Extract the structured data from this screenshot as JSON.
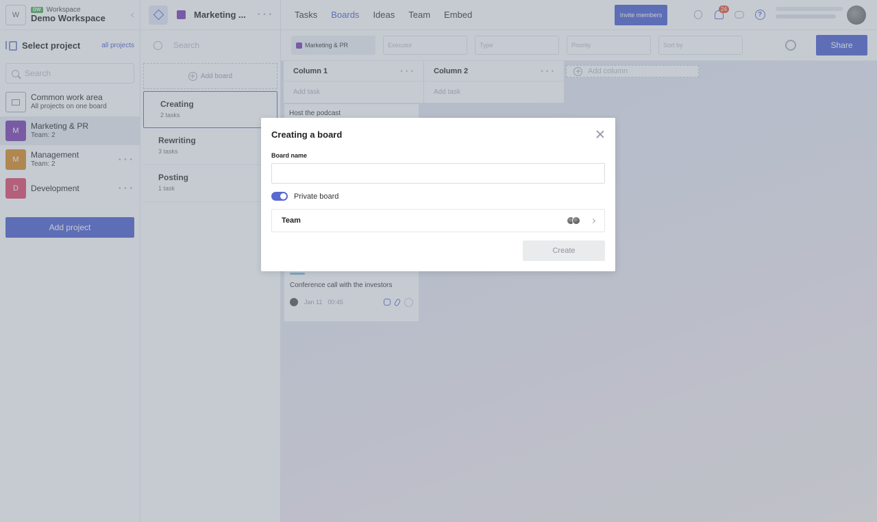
{
  "workspace": {
    "badge": "DW",
    "label": "Workspace",
    "name": "Demo Workspace",
    "avatar": "W"
  },
  "sidebar": {
    "select_title": "Select project",
    "all_projects": "all projects",
    "search_placeholder": "Search",
    "projects": [
      {
        "name": "Common work area",
        "sub": "All projects on one board"
      },
      {
        "letter": "M",
        "name": "Marketing & PR",
        "sub": "Team: 2",
        "color": "#7b3fb2"
      },
      {
        "letter": "M",
        "name": "Management",
        "sub": "Team: 2",
        "color": "#d98a1f"
      },
      {
        "letter": "D",
        "name": "Development",
        "sub": "",
        "color": "#e0476a"
      }
    ],
    "add_project": "Add project"
  },
  "boards": {
    "project_title": "Marketing ...",
    "search_placeholder": "Search",
    "add_board": "Add board",
    "items": [
      {
        "name": "Creating",
        "sub": "2 tasks"
      },
      {
        "name": "Rewriting",
        "sub": "3 tasks"
      },
      {
        "name": "Posting",
        "sub": "1 task"
      }
    ]
  },
  "topnav": {
    "links": [
      "Tasks",
      "Boards",
      "Ideas",
      "Team",
      "Embed"
    ],
    "invite": "Invite members",
    "notifications": "24",
    "help": "?"
  },
  "filters": {
    "project": "Marketing & PR",
    "executor": "Executor",
    "type": "Type",
    "priority": "Priority",
    "sort": "Sort by",
    "share": "Share"
  },
  "columns": [
    {
      "title": "Column 1",
      "add": "Add task"
    },
    {
      "title": "Column 2",
      "add": "Add task"
    }
  ],
  "add_column": "Add column",
  "tasks": {
    "first": "Host the podcast",
    "second": {
      "title": "Conference call with the investors",
      "date": "Jan 11",
      "time": "00:45"
    }
  },
  "modal": {
    "title": "Creating a board",
    "name_label": "Board name",
    "name_value": "",
    "private_label": "Private board",
    "private_on": true,
    "team_label": "Team",
    "create": "Create"
  },
  "colors": {
    "accent": "#4a5fcf",
    "project_marketing": "#7b3fb2",
    "badge_red": "#e5533d"
  }
}
